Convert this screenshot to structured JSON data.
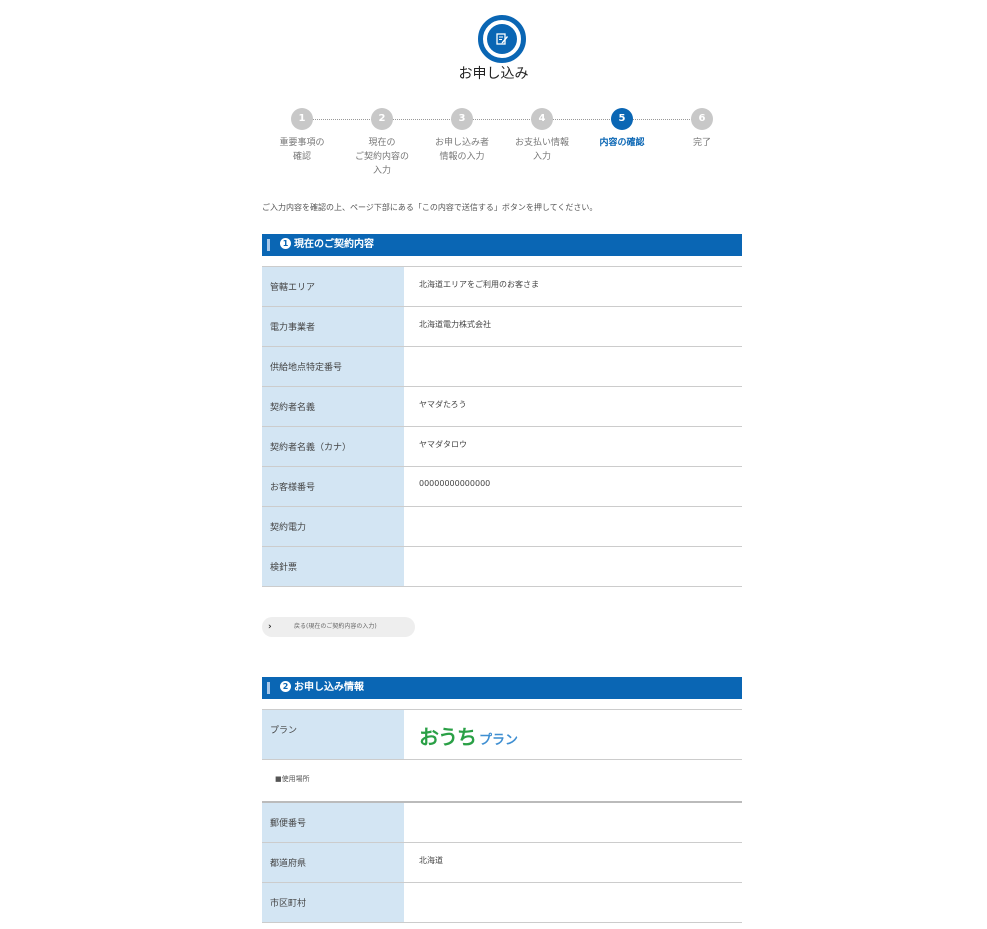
{
  "header": {
    "icon": "edit-icon",
    "title": "お申し込み"
  },
  "steps": [
    {
      "number": "1",
      "label": "重要事項の\n確認",
      "active": false
    },
    {
      "number": "2",
      "label": "現在の\nご契約内容の\n入力",
      "active": false
    },
    {
      "number": "3",
      "label": "お申し込み者\n情報の入力",
      "active": false
    },
    {
      "number": "4",
      "label": "お支払い情報\n入力",
      "active": false
    },
    {
      "number": "5",
      "label": "内容の確認",
      "active": true
    },
    {
      "number": "6",
      "label": "完了",
      "active": false
    }
  ],
  "intro": "ご入力内容を確認の上、ページ下部にある「この内容で送信する」ボタンを押してください。",
  "section1": {
    "number": "1",
    "title": "現在のご契約内容",
    "rows": [
      {
        "label": "管轄エリア",
        "value": "北海道エリアをご利用のお客さま"
      },
      {
        "label": "電力事業者",
        "value": "北海道電力株式会社"
      },
      {
        "label": "供給地点特定番号",
        "value": ""
      },
      {
        "label": "契約者名義",
        "value": "ヤマダたろう"
      },
      {
        "label": "契約者名義（カナ）",
        "value": "ヤマダタロウ"
      },
      {
        "label": "お客様番号",
        "value": "00000000000000"
      },
      {
        "label": "契約電力",
        "value": ""
      },
      {
        "label": "検針票",
        "value": ""
      }
    ],
    "back_label": "戻る(現在のご契約内容の入力)"
  },
  "section2": {
    "number": "2",
    "title": "お申し込み情報",
    "plan_label": "プラン",
    "plan_logo_main": "おうち",
    "plan_logo_sub": "プラン",
    "usage_heading": "■使用場所",
    "rows": [
      {
        "label": "郵便番号",
        "value": ""
      },
      {
        "label": "都道府県",
        "value": "北海道"
      },
      {
        "label": "市区町村",
        "value": ""
      }
    ]
  },
  "colors": {
    "primary": "#0a66b4",
    "label_bg": "#d3e5f3",
    "logo_green": "#2aa046",
    "logo_blue": "#3f8fd2"
  }
}
